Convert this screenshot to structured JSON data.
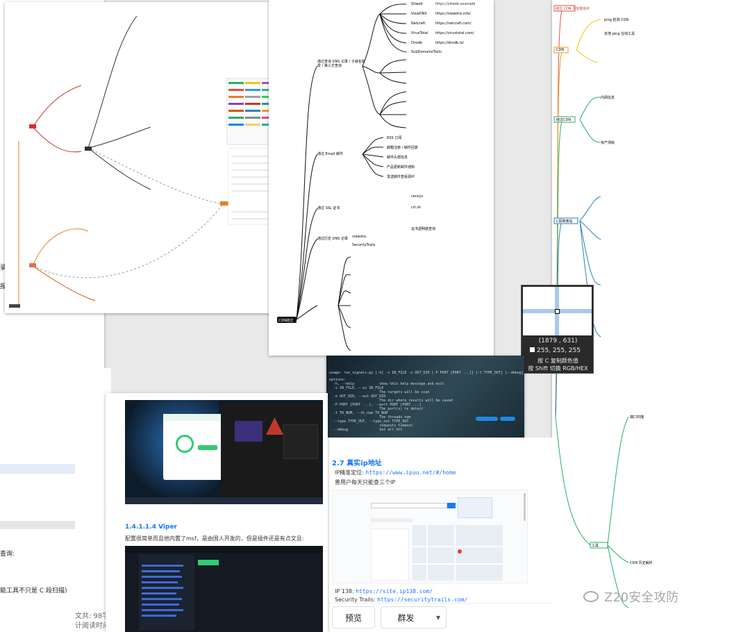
{
  "background_doc": {
    "side_fragments": [
      "录",
      "报",
      "查询:",
      "能工具不只是 C 段扫描)"
    ],
    "footer_left": [
      "文共: 98字",
      "计阅读时间"
    ]
  },
  "panel_mindmap_center": {
    "root_label": "",
    "branches": [
      {
        "label": "通过查询 DNS 记录 / 子域名枚举 / 第三方查询",
        "items": [
          "Sitweb",
          "https://sitweb.example",
          "ViewDNS",
          "https://viewdns.info/",
          "Netcraft",
          "https://netcraft.com/",
          "VirusTotal",
          "https://virustotal.com/",
          "Dnsdb",
          "https://dnsdb.io/",
          "SubDomainsTools"
        ]
      },
      {
        "label": "通过 Email 邮件",
        "items": [
          "RSS 订阅",
          "邮箱注册 / 邮件回复",
          "邮件头部信息",
          "产品更新邮件通知",
          "发送邮件查看源IP"
        ]
      },
      {
        "label": "通过 SSL 证书",
        "items": [
          "censys",
          "crt.sh",
          "证书透明度查询"
        ]
      },
      {
        "label": "通过历史 DNS 记录",
        "items": [
          "viewdns",
          "SecurityTrails"
        ]
      }
    ]
  },
  "panel_mindmap_right": {
    "title_red": "绕过 CDN 寻找真实IP",
    "nodes": [
      "CDN",
      "绕过CDN",
      "C段和旁站",
      "ping 检测 CDN",
      "多地 ping 在线工具",
      "内网信息",
      "资产测绘",
      "工具",
      "端口扫描",
      "CDN 历史解析"
    ]
  },
  "color_picker": {
    "coords": "(1879 , 631)",
    "rgb": "255, 255, 255",
    "hint_line1": "按 C 复制颜色值",
    "hint_line2": "按 Shift 切换 RGB/HEX"
  },
  "terminal_panel": {
    "lines": [
      "usage: run_signals.py [-h] -s IN_FILE -o OUT_DIR [-P PORT [PORT ...]] [-t TYPE_OUT] [--debug]",
      "options:",
      "  -h, --help            show this help message and exit",
      "  -s IN_FILE, --in IN_FILE",
      "                        The targets will be scan",
      "  -o OUT_DIR, --out OUT_DIR",
      "                        The dir where results will be saved",
      "  -P PORT [PORT ...], --port PORT [PORT ...]",
      "                        The port(s) to detect",
      "  -t TH_NUM, --th_num TH_NUM",
      "                        The threads num",
      "  --type TYPE_OUT, --type_out TYPE_OUT",
      "                        requests timeout",
      "  --debug               Set all htt"
    ]
  },
  "article_panel": {
    "section": "2.7 真实ip地址",
    "line1_prefix": "IP精准定位: ",
    "line1_link": "https://www.ipuu.net/#/home",
    "line2": "普用户每天只能查三个IP",
    "ip138_prefix": "IP 138: ",
    "ip138_link": "https://site.ip138.com/",
    "st_prefix": "Security Trails: ",
    "st_link": "https://securitytrails.com/"
  },
  "viper_panel": {
    "heading": "1.4.1.1.4 Viper",
    "desc": "配置很简单而且他内置了msf，是由国人开发的，但是插件还是有点文旦:"
  },
  "bottom_buttons": {
    "preview": "预览",
    "publish": "群发",
    "dropdown": "▾"
  },
  "watermark": {
    "text": "Z20安全攻防"
  },
  "colors": {
    "accent_blue": "#1677ff",
    "mindmap_dark": "#1f1f1f",
    "terminal_bg": "#1c2a35",
    "viper_bg": "#151a22"
  }
}
